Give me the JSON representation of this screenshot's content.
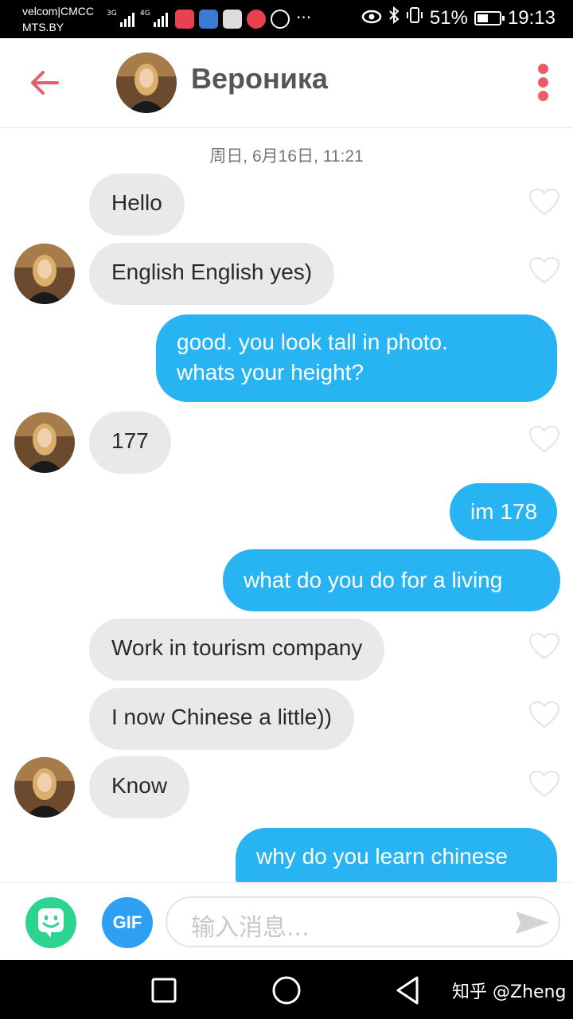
{
  "status_bar": {
    "carrier_line1": "velcom|CMCC",
    "carrier_line2": "MTS.BY",
    "network_1": "3G",
    "network_2": "4G",
    "battery_percent_text": "51%",
    "battery_level": 0.51,
    "time": "19:13"
  },
  "header": {
    "contact_name": "Вероника",
    "back_icon": "arrow-left-icon",
    "menu_icon": "more-vertical-icon",
    "accent_color": "#e85d68"
  },
  "chat": {
    "timestamp": "周日, 6月16日, 11:21",
    "messages": [
      {
        "from": "them",
        "text": "Hello"
      },
      {
        "from": "them",
        "text": "English  English  yes)"
      },
      {
        "from": "me",
        "line1": "good. you look tall in photo.",
        "line2": "whats your height?"
      },
      {
        "from": "them",
        "text": "177"
      },
      {
        "from": "me",
        "text": "im 178"
      },
      {
        "from": "me",
        "text": "what do you do for a living"
      },
      {
        "from": "them",
        "text": "Work  in tourism  company"
      },
      {
        "from": "them",
        "text": "I now Chinese a little))"
      },
      {
        "from": "them",
        "text": "Know"
      },
      {
        "from": "me",
        "text": "why do you learn chinese"
      }
    ],
    "incoming_color": "#e9e9e9",
    "outgoing_color": "#28b4f2"
  },
  "input_bar": {
    "gif_label": "GIF",
    "placeholder": "输入消息...",
    "emoji_icon": "emoji-face-icon",
    "send_icon": "send-icon"
  },
  "nav_bar": {
    "watermark": "知乎 @Zheng"
  }
}
